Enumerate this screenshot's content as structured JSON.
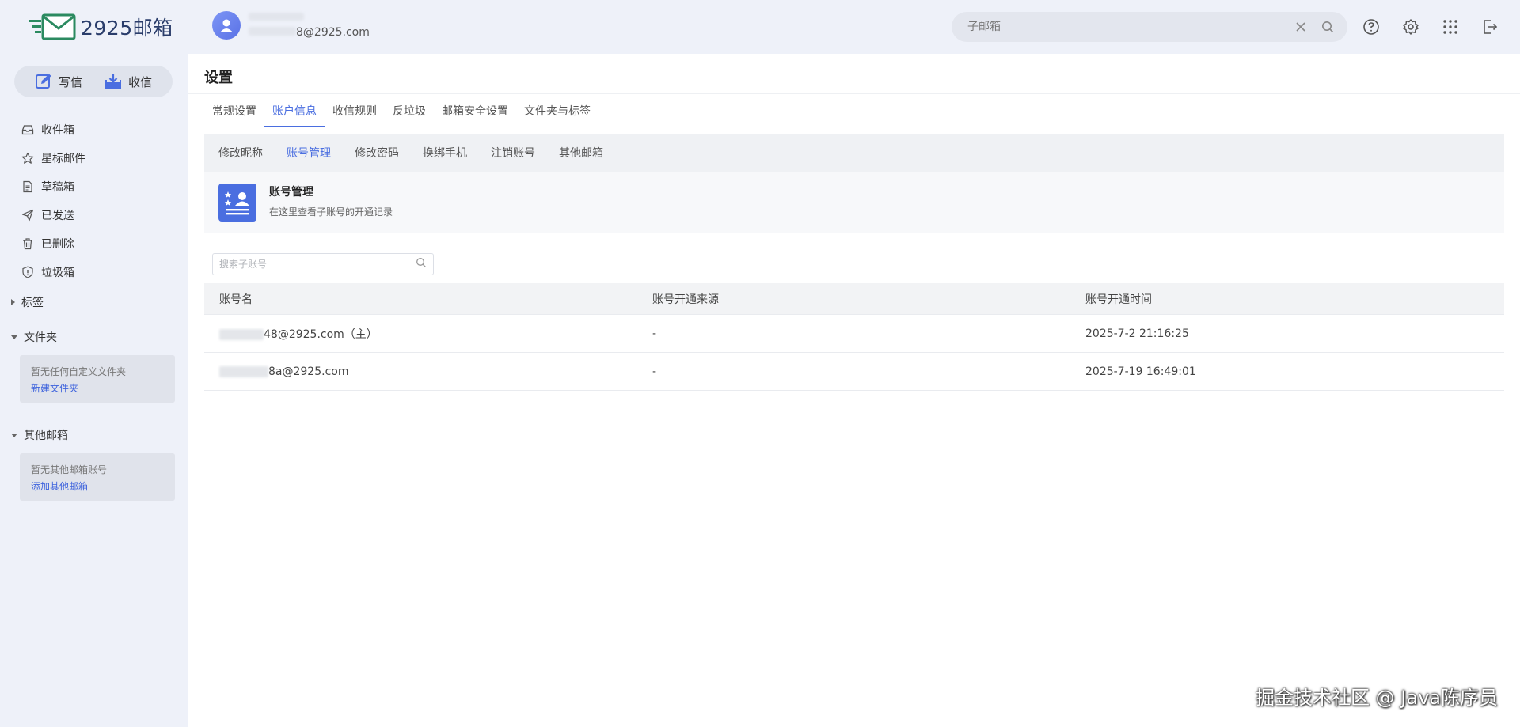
{
  "app": {
    "logo_text": "2925邮箱"
  },
  "user": {
    "name": "",
    "email_suffix": "8@2925.com"
  },
  "header": {
    "search_placeholder": "子邮箱",
    "icons": [
      "help-icon",
      "gear-icon",
      "apps-grid-icon",
      "logout-icon"
    ]
  },
  "sidebar": {
    "compose_label": "写信",
    "receive_label": "收信",
    "items": [
      {
        "label": "收件箱",
        "icon": "inbox-icon"
      },
      {
        "label": "星标邮件",
        "icon": "star-icon"
      },
      {
        "label": "草稿箱",
        "icon": "draft-icon"
      },
      {
        "label": "已发送",
        "icon": "send-icon"
      },
      {
        "label": "已删除",
        "icon": "trash-icon"
      },
      {
        "label": "垃圾箱",
        "icon": "spam-shield-icon"
      }
    ],
    "tags_label": "标签",
    "folders_label": "文件夹",
    "folders_empty": "暂无任何自定义文件夹",
    "folders_new": "新建文件夹",
    "other_label": "其他邮箱",
    "other_empty": "暂无其他邮箱账号",
    "other_add": "添加其他邮箱"
  },
  "main": {
    "title": "设置",
    "tabs": [
      "常规设置",
      "账户信息",
      "收信规则",
      "反垃圾",
      "邮箱安全设置",
      "文件夹与标签"
    ],
    "active_tab": "账户信息",
    "subtabs": [
      "修改昵称",
      "账号管理",
      "修改密码",
      "换绑手机",
      "注销账号",
      "其他邮箱"
    ],
    "active_subtab": "账号管理",
    "card_title": "账号管理",
    "card_desc": "在这里查看子账号的开通记录",
    "sub_search_placeholder": "搜索子账号",
    "table": {
      "headers": [
        "账号名",
        "账号开通来源",
        "账号开通时间"
      ],
      "rows": [
        {
          "name": "48@2925.com（主）",
          "source": "-",
          "time": "2025-7-2 21:16:25"
        },
        {
          "name": "8a@2925.com",
          "source": "-",
          "time": "2025-7-19 16:49:01"
        }
      ]
    }
  },
  "watermark": "掘金技术社区 @ Java陈序员",
  "colors": {
    "accent": "#4a6ee0",
    "background": "#eef1f9"
  }
}
